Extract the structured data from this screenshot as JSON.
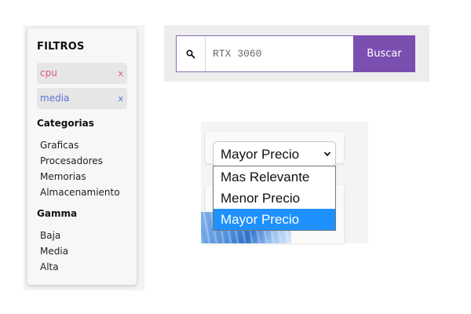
{
  "filters": {
    "title": "FILTROS",
    "active": [
      {
        "label": "cpu",
        "remove": "x",
        "color": "#e0558d"
      },
      {
        "label": "media",
        "remove": "x",
        "color": "#5b72d8"
      }
    ],
    "categorias": {
      "title": "Categorias",
      "items": [
        "Graficas",
        "Procesadores",
        "Memorias",
        "Almacenamiento"
      ]
    },
    "gamma": {
      "title": "Gamma",
      "items": [
        "Baja",
        "Media",
        "Alta"
      ]
    }
  },
  "search": {
    "value": "",
    "placeholder": "RTX 3060",
    "button_label": "Buscar",
    "icon": "search-icon",
    "accent": "#7a4fb0"
  },
  "sort": {
    "selected": "Mayor Precio",
    "icon": "chevron-down-icon",
    "options": [
      {
        "label": "Mas Relevante",
        "selected": false
      },
      {
        "label": "Menor Precio",
        "selected": false
      },
      {
        "label": "Mayor Precio",
        "selected": true
      }
    ],
    "highlight_color": "#1e90ff"
  }
}
